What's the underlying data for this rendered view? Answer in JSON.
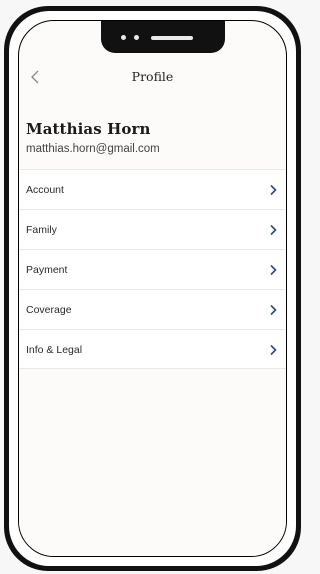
{
  "header": {
    "title": "Profile"
  },
  "user": {
    "name": "Matthias Horn",
    "email": "matthias.horn@gmail.com"
  },
  "menu": {
    "items": [
      {
        "label": "Account"
      },
      {
        "label": "Family"
      },
      {
        "label": "Payment"
      },
      {
        "label": "Coverage"
      },
      {
        "label": "Info & Legal"
      }
    ]
  },
  "icons": {
    "back": "chevron-left-icon",
    "item": "chevron-right-icon"
  },
  "colors": {
    "accent": "#2a4a7a",
    "background": "#fdfbfa",
    "frame": "#111111"
  }
}
